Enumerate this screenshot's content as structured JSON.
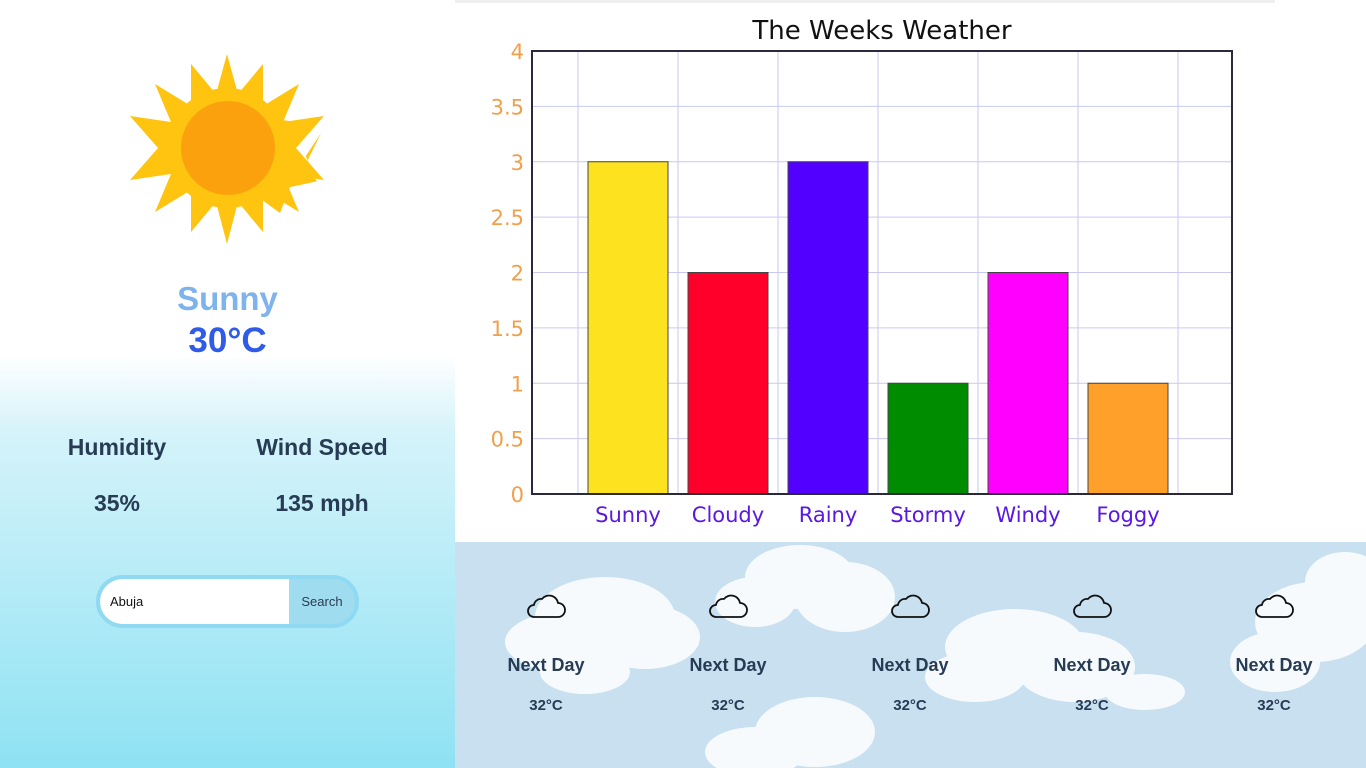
{
  "current": {
    "icon": "sun-icon",
    "condition": "Sunny",
    "temperature": "30°C"
  },
  "stats": {
    "humidity_label": "Humidity",
    "humidity_value": "35%",
    "wind_label": "Wind Speed",
    "wind_value": "135 mph"
  },
  "search": {
    "value": "Abuja",
    "button_label": "Search"
  },
  "colors": {
    "condition_text": "#7fb3ec",
    "temperature_text": "#2f5be8",
    "stat_text": "#273c54",
    "search_accent": "#9fdcf0"
  },
  "chart_data": {
    "type": "bar",
    "title": "The Weeks Weather",
    "categories": [
      "Sunny",
      "Cloudy",
      "Rainy",
      "Stormy",
      "Windy",
      "Foggy"
    ],
    "values": [
      3,
      2,
      3,
      1,
      2,
      1
    ],
    "bar_colors": [
      "#fde31f",
      "#ff002b",
      "#5200ff",
      "#008c00",
      "#ff00ff",
      "#ffa02a"
    ],
    "yticks": [
      "0",
      "0.5",
      "1",
      "1.5",
      "2",
      "2.5",
      "3",
      "3.5",
      "4"
    ],
    "ylim": [
      0,
      4
    ],
    "grid": true,
    "xlabel": "",
    "ylabel": ""
  },
  "forecast": [
    {
      "icon": "cloud-icon",
      "day": "Next Day",
      "temp": "32°C"
    },
    {
      "icon": "cloud-icon",
      "day": "Next Day",
      "temp": "32°C"
    },
    {
      "icon": "cloud-icon",
      "day": "Next Day",
      "temp": "32°C"
    },
    {
      "icon": "cloud-icon",
      "day": "Next Day",
      "temp": "32°C"
    },
    {
      "icon": "cloud-icon",
      "day": "Next Day",
      "temp": "32°C"
    }
  ]
}
